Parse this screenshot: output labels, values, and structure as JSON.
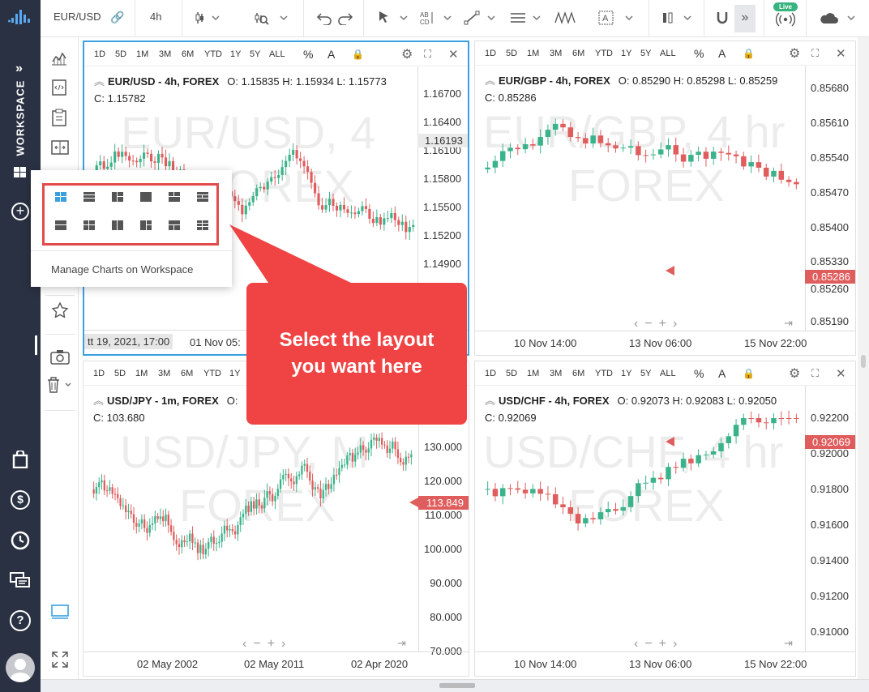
{
  "toolbar": {
    "symbol": "EUR/USD",
    "interval": "4h",
    "live_badge": "Live",
    "more": "»"
  },
  "sidebar": {
    "workspace_label": "WORKSPACE",
    "expand": "»"
  },
  "popup": {
    "manage_label": "Manage Charts on Workspace"
  },
  "callout": {
    "line1": "Select the layout",
    "line2": "you want here"
  },
  "timeframes": [
    "1D",
    "5D",
    "1M",
    "3M",
    "6M",
    "YTD",
    "1Y",
    "5Y",
    "ALL"
  ],
  "charts": [
    {
      "symbol": "EUR/USD - 4h, FOREX",
      "ohlc": "O: 1.15835  H: 1.15934  L: 1.15773",
      "close": "C: 1.15782",
      "watermark1": "EUR/USD, 4",
      "watermark2": "FOREX",
      "yticks": [
        "1.16700",
        "1.16400",
        "1.16100",
        "1.15800",
        "1.15500",
        "1.15200",
        "1.14900"
      ],
      "price_tag": "1.16193",
      "crosshair_time": "tt 19, 2021, 17:00",
      "xticks": [
        "01 Nov 05:"
      ]
    },
    {
      "symbol": "EUR/GBP - 4h, FOREX",
      "ohlc": "O: 0.85290  H: 0.85298  L: 0.85259",
      "close": "C: 0.85286",
      "watermark1": "EUR/GBP, 4 hr",
      "watermark2": "FOREX",
      "yticks": [
        "0.85680",
        "0.85610",
        "0.85540",
        "0.85470",
        "0.85400",
        "0.85330",
        "0.85260",
        "0.85190"
      ],
      "price_tag": "0.85286",
      "xticks": [
        "10 Nov 14:00",
        "13 Nov 06:00",
        "15 Nov 22:00"
      ]
    },
    {
      "symbol": "USD/JPY - 1m, FOREX",
      "ohlc": "O:",
      "close": "C: 103.680",
      "watermark1": "USD/JPY, M",
      "watermark2": "FOREX",
      "yticks": [
        "130.000",
        "120.000",
        "110.000",
        "100.000",
        "90.000",
        "80.000",
        "70.000"
      ],
      "price_tag": "113.849",
      "xticks": [
        "02 May 2002",
        "02 May 2011",
        "02 Apr 2020"
      ]
    },
    {
      "symbol": "USD/CHF - 4h, FOREX",
      "ohlc": "O: 0.92073  H: 0.92083  L: 0.92050",
      "close": "C: 0.92069",
      "watermark1": "USD/CHF, 4 hr",
      "watermark2": "FOREX",
      "yticks": [
        "0.92200",
        "0.92000",
        "0.91800",
        "0.91600",
        "0.91400",
        "0.91200",
        "0.91000"
      ],
      "price_tag": "0.92069",
      "xticks": [
        "10 Nov 14:00",
        "13 Nov 06:00",
        "15 Nov 22:00"
      ]
    }
  ],
  "colors": {
    "up": "#3bb38a",
    "down": "#e05d5d",
    "accent": "#3aa0e0",
    "nav": "#2a3142",
    "callout": "#f04444"
  }
}
